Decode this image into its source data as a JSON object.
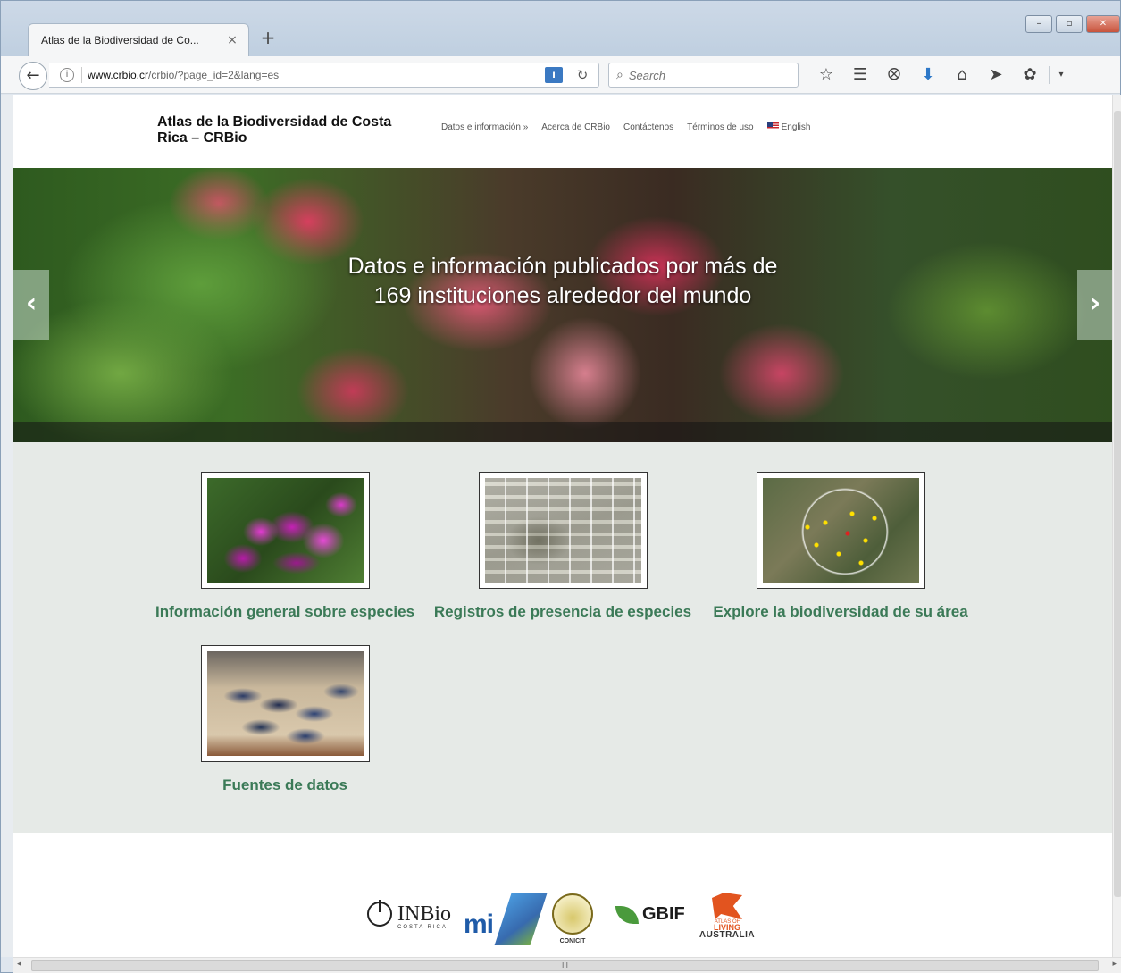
{
  "browser": {
    "tab_title": "Atlas de la Biodiversidad de Co...",
    "tab_close": "×",
    "new_tab": "+",
    "url_host": "www.crbio.cr",
    "url_path": "/crbio/?page_id=2&lang=es",
    "search_placeholder": "Search",
    "window_buttons": {
      "minimize": "–",
      "maximize": "▫",
      "close": "✕"
    },
    "toolbar_icons": [
      "star-icon",
      "reading-list-icon",
      "pocket-icon",
      "download-icon",
      "home-icon",
      "send-icon",
      "extension-icon",
      "menu-icon"
    ],
    "scroll_thumb_grip": "III"
  },
  "site": {
    "title": "Atlas de la Biodiversidad de Costa Rica – CRBio",
    "nav": [
      {
        "label": "Datos e información »"
      },
      {
        "label": "Acerca de CRBio"
      },
      {
        "label": "Contáctenos"
      },
      {
        "label": "Términos de uso"
      },
      {
        "label": "English"
      }
    ]
  },
  "hero": {
    "caption_line1": "Datos e información publicados por más de",
    "caption_line2": "169 instituciones alrededor del mundo",
    "prev_label": "‹",
    "next_label": "›"
  },
  "features": [
    {
      "label": "Información general sobre especies",
      "image": "orchid-photo"
    },
    {
      "label": "Registros de presencia de especies",
      "image": "specimen-drawers-photo"
    },
    {
      "label": "Explore la biodiversidad de su área",
      "image": "occurrence-map"
    },
    {
      "label": "Fuentes de datos",
      "image": "butterfly-collection-photo"
    }
  ],
  "partners": {
    "inbio": "INBio",
    "inbio_sub": "COSTA RICA",
    "micitt": "mi",
    "conicit": "CONICIT",
    "gbif": "GBIF",
    "ala_small": "ATLAS OF",
    "ala_living": "LIVING",
    "ala_australia": "AUSTRALIA"
  },
  "colors": {
    "feature_label": "#3b7a57",
    "features_bg": "#e6eae7",
    "accent_blue": "#2d78c8"
  }
}
